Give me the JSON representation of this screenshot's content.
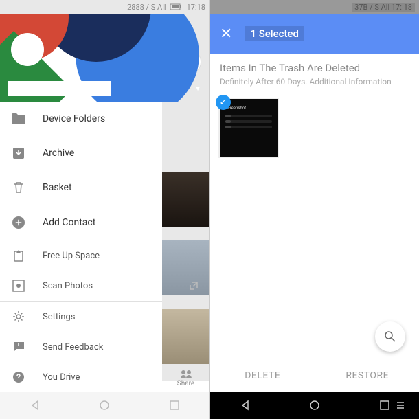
{
  "left": {
    "status": {
      "text": "2888 / S All",
      "time": "17:18"
    },
    "menu": {
      "device_folders": "Device Folders",
      "archive": "Archive",
      "basket": "Basket",
      "add_contact": "Add Contact",
      "free_up_space": "Free Up Space",
      "scan_photos": "Scan Photos",
      "settings": "Settings",
      "send_feedback": "Send Feedback",
      "you_drive": "You Drive"
    },
    "bottom_tab": "Share"
  },
  "right": {
    "status": {
      "text": "37B / S All 17: 18"
    },
    "header": {
      "selection": "1 Selected"
    },
    "trash": {
      "title": "Items In The Trash Are Deleted",
      "subtitle": "Definitely After 60 Days. Additional Information"
    },
    "actions": {
      "delete": "DELETE",
      "restore": "RESTORE"
    }
  }
}
